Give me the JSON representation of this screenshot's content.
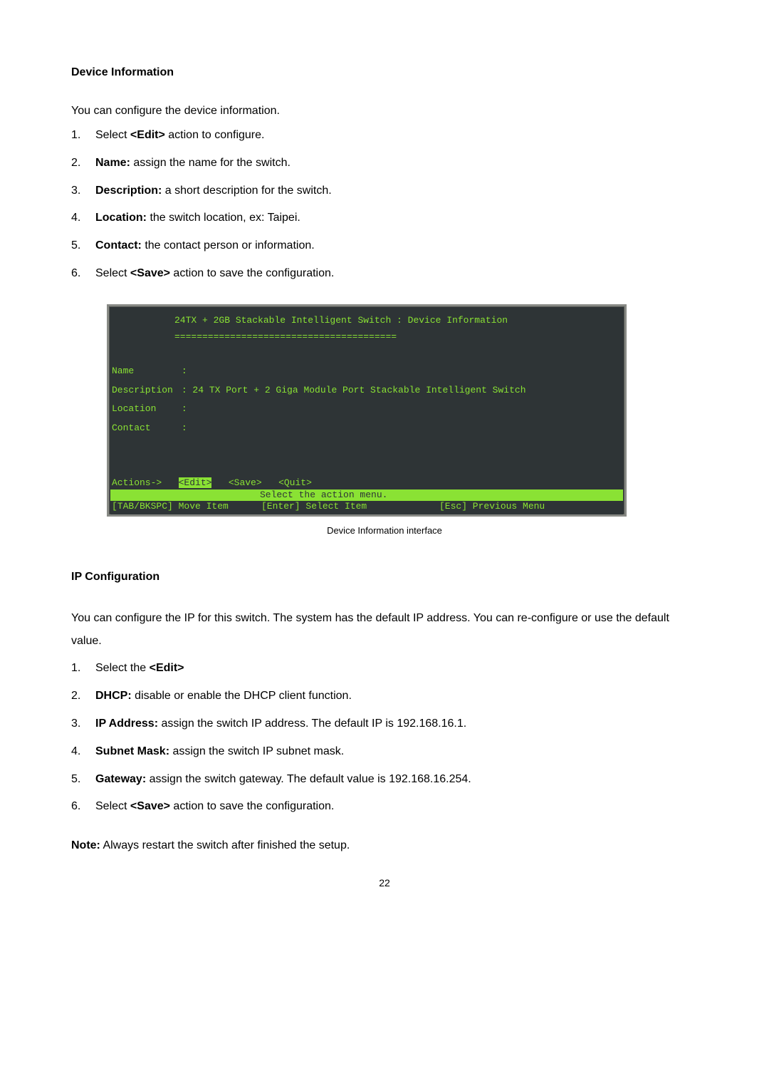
{
  "section1": {
    "heading": "Device Information",
    "intro": "You can configure the device information.",
    "items": [
      {
        "num": "1.",
        "label": "",
        "text_prefix": "Select ",
        "bold_inline": "<Edit>",
        "text_suffix": " action to configure."
      },
      {
        "num": "2.",
        "label": "Name:",
        "text_prefix": "",
        "bold_inline": "",
        "text_suffix": " assign the name for the switch."
      },
      {
        "num": "3.",
        "label": "Description:",
        "text_prefix": "",
        "bold_inline": "",
        "text_suffix": " a short description for the switch."
      },
      {
        "num": "4.",
        "label": "Location:",
        "text_prefix": "",
        "bold_inline": "",
        "text_suffix": " the switch location, ex: Taipei."
      },
      {
        "num": "5.",
        "label": "Contact:",
        "text_prefix": "",
        "bold_inline": "",
        "text_suffix": " the contact person or information."
      },
      {
        "num": "6.",
        "label": "",
        "text_prefix": "Select ",
        "bold_inline": "<Save>",
        "text_suffix": " action to save the configuration."
      }
    ]
  },
  "terminal": {
    "title": "24TX + 2GB Stackable Intelligent Switch : Device Information",
    "divider": "========================================",
    "name_label": "Name",
    "name_value": ":",
    "desc_label": "Description",
    "desc_value": ": 24 TX Port + 2 Giga Module Port Stackable Intelligent Switch",
    "loc_label": "Location",
    "loc_value": ":",
    "contact_label": "Contact",
    "contact_value": ":",
    "actions_prefix": "Actions->",
    "action_edit": "<Edit>",
    "action_save": "<Save>",
    "action_quit": "<Quit>",
    "select_msg": "Select the action menu.",
    "hint_move": "[TAB/BKSPC] Move Item",
    "hint_select": "[Enter] Select Item",
    "hint_prev": "[Esc] Previous Menu"
  },
  "caption": "Device Information interface",
  "section2": {
    "heading": "IP Configuration",
    "intro": "You can configure the IP for this switch. The system has the default IP address. You can re-configure or use the default value.",
    "items": [
      {
        "num": "1.",
        "label": "",
        "text_prefix": "Select the ",
        "bold_inline": "<Edit>",
        "text_suffix": ""
      },
      {
        "num": "2.",
        "label": "DHCP:",
        "text_prefix": "",
        "bold_inline": "",
        "text_suffix": " disable or enable the DHCP client function."
      },
      {
        "num": "3.",
        "label": "IP Address:",
        "text_prefix": "",
        "bold_inline": "",
        "text_suffix": " assign the switch IP address. The default IP is 192.168.16.1."
      },
      {
        "num": "4.",
        "label": "Subnet Mask:",
        "text_prefix": "",
        "bold_inline": "",
        "text_suffix": " assign the switch IP subnet mask."
      },
      {
        "num": "5.",
        "label": "Gateway:",
        "text_prefix": "",
        "bold_inline": "",
        "text_suffix": " assign the switch gateway. The default value is 192.168.16.254."
      },
      {
        "num": "6.",
        "label": "",
        "text_prefix": "Select ",
        "bold_inline": "<Save>",
        "text_suffix": " action to save the configuration."
      }
    ],
    "note_label": "Note:",
    "note_text": " Always restart the switch after finished the setup."
  },
  "page_number": "22"
}
